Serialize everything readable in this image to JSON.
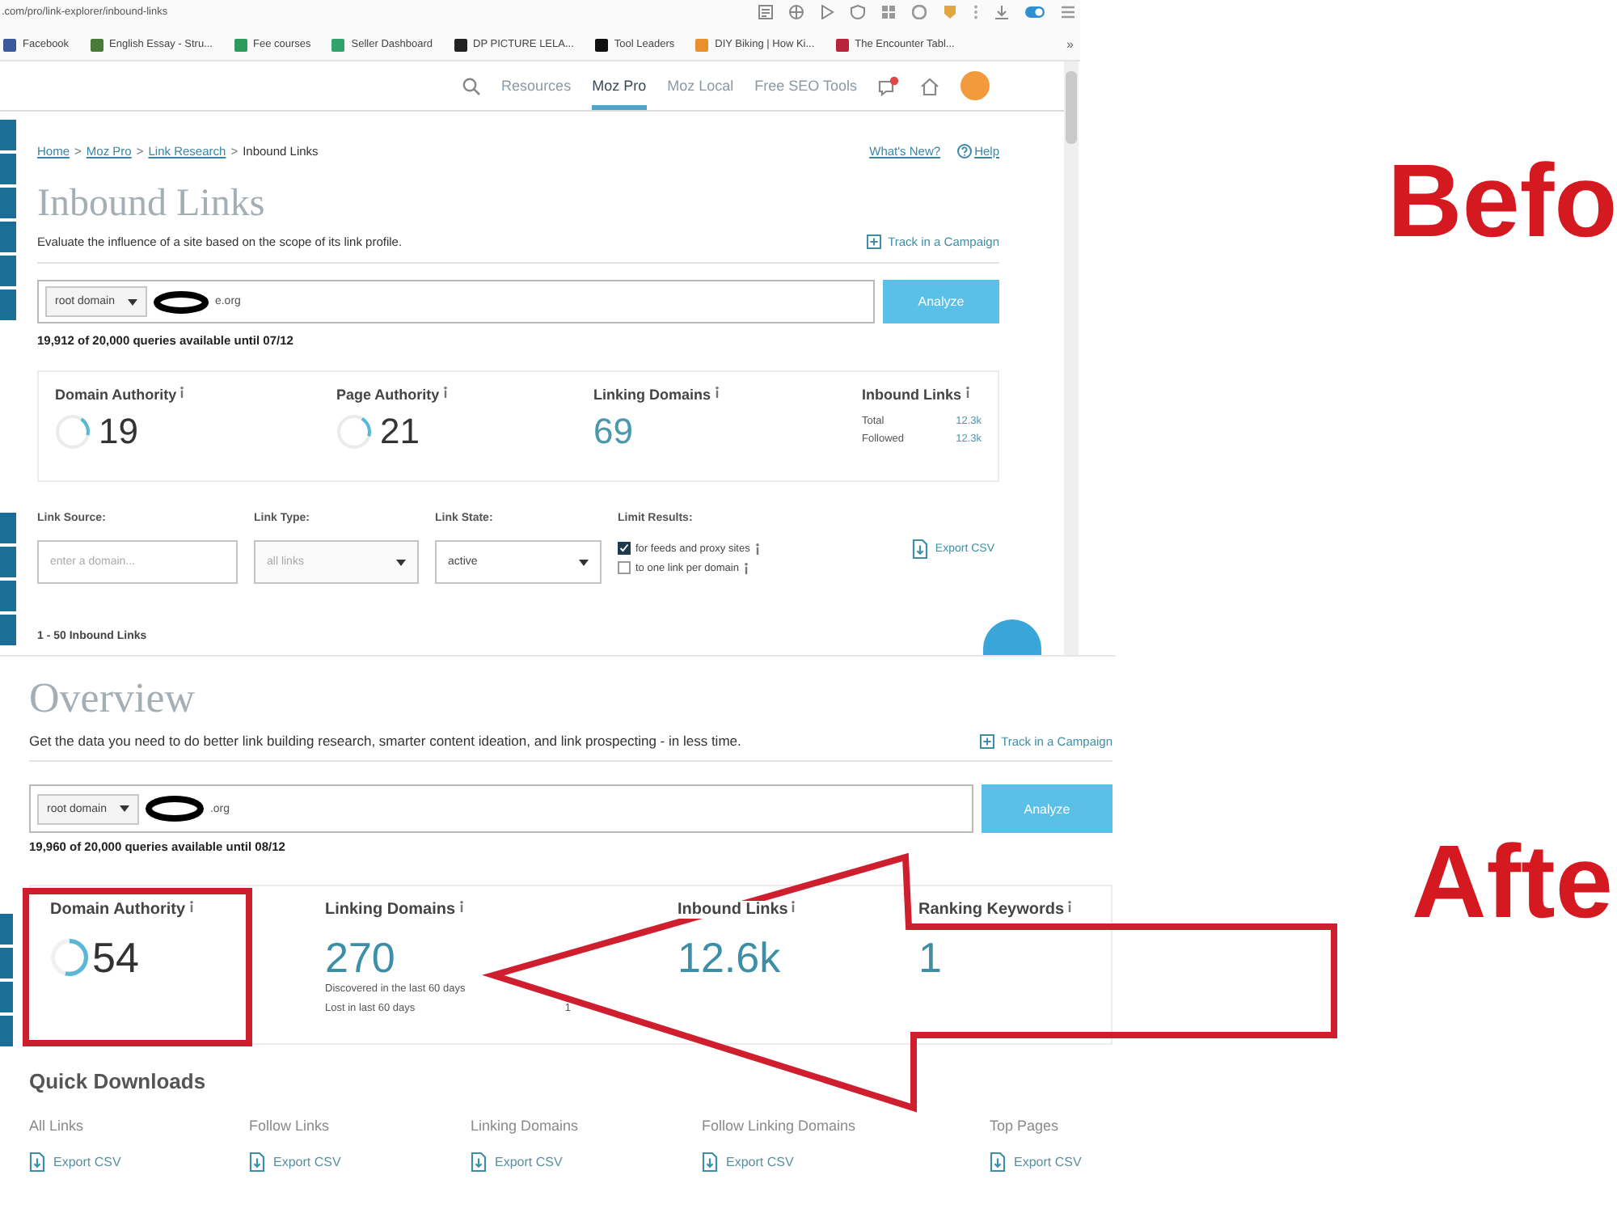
{
  "before": {
    "label": "Befo",
    "browser": {
      "url": ".com/pro/link-explorer/inbound-links",
      "bookmarks": [
        {
          "label": "Facebook",
          "color": "#3b5998"
        },
        {
          "label": "English Essay - Stru...",
          "color": "#4a7a3a"
        },
        {
          "label": "Fee courses",
          "color": "#2e9b5a"
        },
        {
          "label": "Seller Dashboard",
          "color": "#2fa36b"
        },
        {
          "label": "DP PICTURE LELA...",
          "color": "#222222"
        },
        {
          "label": "Tool Leaders",
          "color": "#111111"
        },
        {
          "label": "DIY Biking | How Ki...",
          "color": "#e8912c"
        },
        {
          "label": "The Encounter Tabl...",
          "color": "#b8253a"
        }
      ],
      "overflow": "»"
    },
    "nav": [
      {
        "label": "Resources",
        "selected": false
      },
      {
        "label": "Moz Pro",
        "selected": true
      },
      {
        "label": "Moz Local",
        "selected": false
      },
      {
        "label": "Free SEO Tools",
        "selected": false
      }
    ],
    "breadcrumb": [
      {
        "kind": "link",
        "text": "Home"
      },
      {
        "kind": "separator",
        "text": ">"
      },
      {
        "kind": "link",
        "text": "Moz Pro"
      },
      {
        "kind": "separator",
        "text": ">"
      },
      {
        "kind": "link",
        "text": "Link Research"
      },
      {
        "kind": "separator",
        "text": ">"
      },
      {
        "kind": "current",
        "text": "Inbound Links"
      }
    ],
    "whats_new": "What's New?",
    "help": "Help",
    "title": "Inbound Links",
    "subtitle": "Evaluate the influence of a site based on the scope of its link profile.",
    "track": "Track in a Campaign",
    "search": {
      "scope": "root domain",
      "value": "e.org"
    },
    "analyze": "Analyze",
    "quota": "19,912 of 20,000 queries available until 07/12",
    "metrics": [
      {
        "kind": "gauge",
        "label": "Domain Authority",
        "value": "19",
        "level": 0.19
      },
      {
        "kind": "gauge",
        "label": "Page Authority",
        "value": "21",
        "level": 0.21
      },
      {
        "kind": "number",
        "label": "Linking Domains",
        "value": "69"
      },
      {
        "kind": "breakdown",
        "label": "Inbound Links",
        "rows": [
          {
            "label": "Total",
            "value": "12.3k"
          },
          {
            "label": "Followed",
            "value": "12.3k"
          }
        ]
      }
    ],
    "filters": [
      {
        "kind": "text",
        "label": "Link Source:",
        "placeholder": "enter a domain..."
      },
      {
        "kind": "select",
        "label": "Link Type:",
        "value": "all links",
        "disabled": true
      },
      {
        "kind": "select",
        "label": "Link State:",
        "value": "active",
        "disabled": false
      },
      {
        "kind": "checks",
        "label": "Limit Results:",
        "options": [
          {
            "label": "for feeds and proxy sites",
            "checked": true
          },
          {
            "label": "to one link per domain",
            "checked": false
          }
        ]
      }
    ],
    "export": "Export CSV",
    "results": "1 - 50 Inbound Links"
  },
  "after": {
    "label": "Afte",
    "title": "Overview",
    "subtitle": "Get the data you need to do better link building research, smarter content ideation, and link prospecting - in less time.",
    "track": "Track in a Campaign",
    "search": {
      "scope": "root domain",
      "value": ".org"
    },
    "analyze": "Analyze",
    "quota": "19,960 of 20,000 queries available until 08/12",
    "metrics": [
      {
        "kind": "gauge",
        "label": "Domain Authority",
        "value": "54",
        "level": 0.54,
        "highlighted": true
      },
      {
        "kind": "number",
        "label": "Linking Domains",
        "value": "270",
        "highlighted": false,
        "rows": [
          {
            "label": "Discovered in the last 60 days"
          },
          {
            "label": "Lost in last 60 days",
            "value": "1"
          }
        ]
      },
      {
        "kind": "number",
        "label": "Inbound Links",
        "value": "12.6k",
        "highlighted": false
      },
      {
        "kind": "number",
        "label": "Ranking Keywords",
        "value": "1",
        "highlighted": false
      }
    ],
    "downloads": {
      "title": "Quick Downloads",
      "items": [
        {
          "label": "All Links",
          "action": "Export CSV"
        },
        {
          "label": "Follow Links",
          "action": "Export CSV"
        },
        {
          "label": "Linking Domains",
          "action": "Export CSV"
        },
        {
          "label": "Follow Linking Domains",
          "action": "Export CSV"
        },
        {
          "label": "Top Pages",
          "action": "Export CSV"
        }
      ]
    }
  }
}
